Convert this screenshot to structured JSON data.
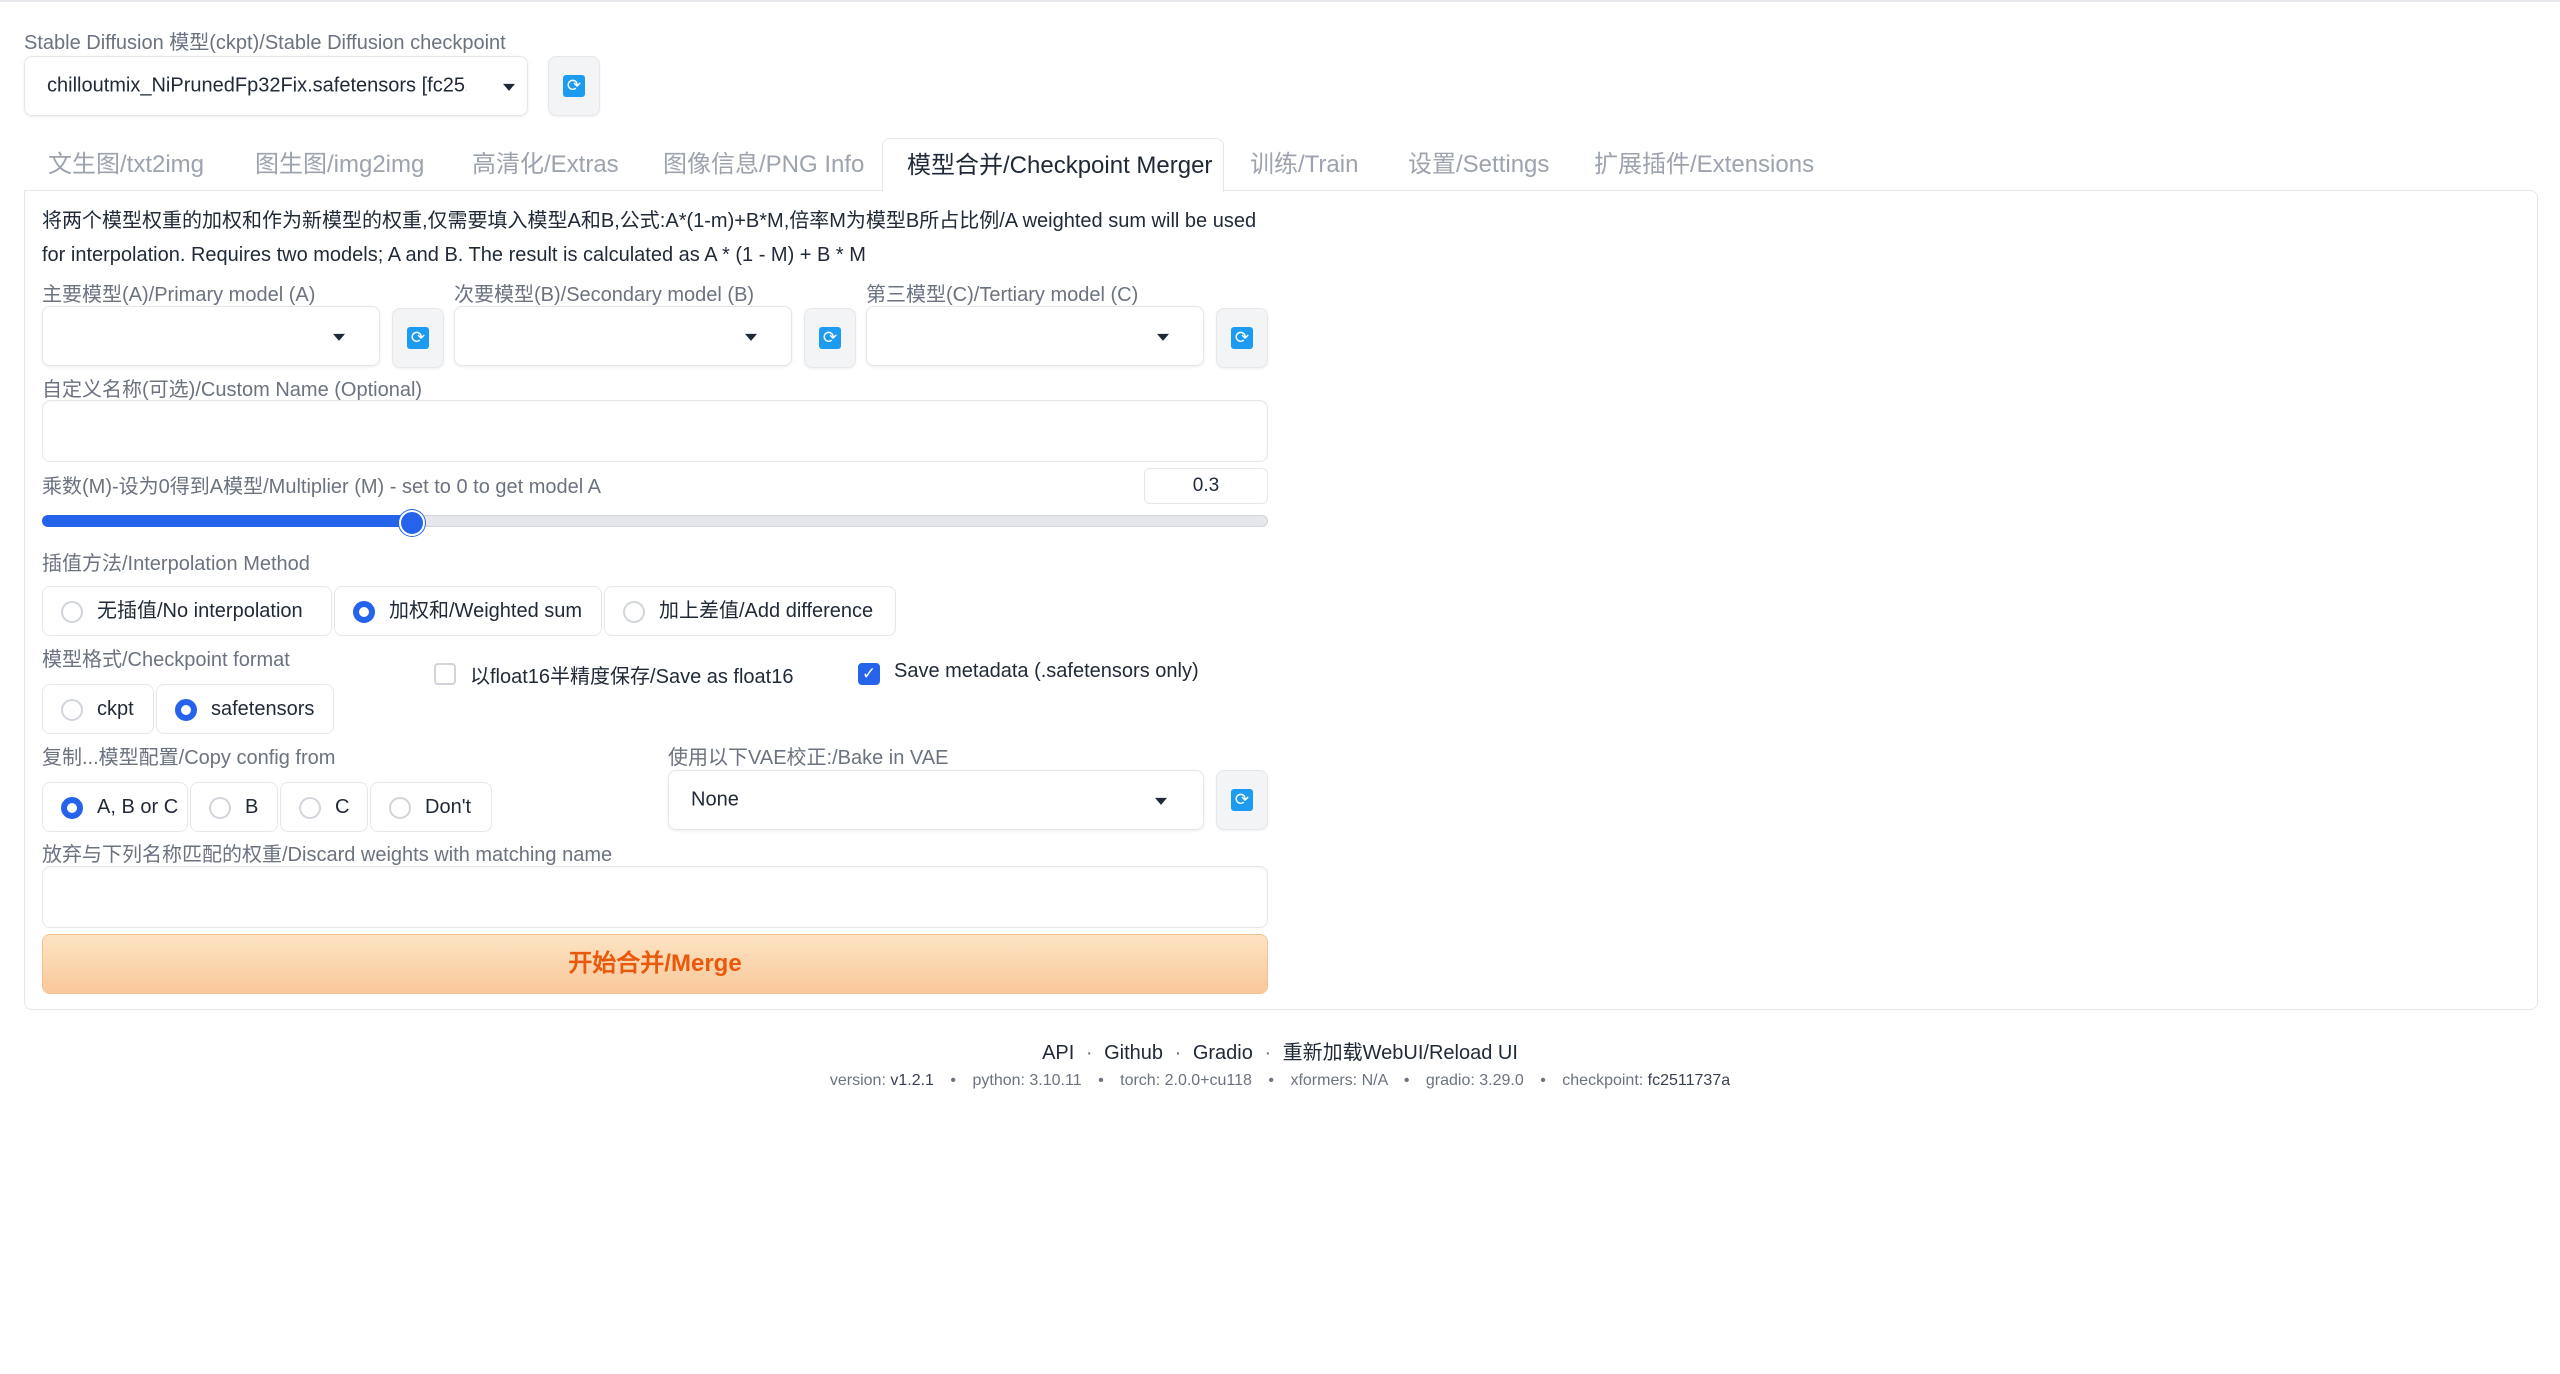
{
  "header": {
    "checkpoint_label": "Stable Diffusion 模型(ckpt)/Stable Diffusion checkpoint",
    "checkpoint_value": "chilloutmix_NiPrunedFp32Fix.safetensors [fc25."
  },
  "tabs": [
    {
      "label": "文生图/txt2img",
      "active": false
    },
    {
      "label": "图生图/img2img",
      "active": false
    },
    {
      "label": "高清化/Extras",
      "active": false
    },
    {
      "label": "图像信息/PNG Info",
      "active": false
    },
    {
      "label": "模型合并/Checkpoint Merger",
      "active": true
    },
    {
      "label": "训练/Train",
      "active": false
    },
    {
      "label": "设置/Settings",
      "active": false
    },
    {
      "label": "扩展插件/Extensions",
      "active": false
    }
  ],
  "merger": {
    "description": "将两个模型权重的加权和作为新模型的权重,仅需要填入模型A和B,公式:A*(1-m)+B*M,倍率M为模型B所占比例/A weighted sum will be used for interpolation. Requires two models; A and B. The result is calculated as A * (1 - M) + B * M",
    "primary_label": "主要模型(A)/Primary model (A)",
    "secondary_label": "次要模型(B)/Secondary model (B)",
    "tertiary_label": "第三模型(C)/Tertiary model (C)",
    "primary_value": "",
    "secondary_value": "",
    "tertiary_value": "",
    "custom_name_label": "自定义名称(可选)/Custom Name (Optional)",
    "custom_name_value": "",
    "multiplier_label": "乘数(M)-设为0得到A模型/Multiplier (M) - set to 0 to get model A",
    "multiplier_value": "0.3",
    "multiplier_fraction": 0.3,
    "interp_label": "插值方法/Interpolation Method",
    "interp_options": [
      {
        "label": "无插值/No interpolation",
        "selected": false
      },
      {
        "label": "加权和/Weighted sum",
        "selected": true
      },
      {
        "label": "加上差值/Add difference",
        "selected": false
      }
    ],
    "format_label": "模型格式/Checkpoint format",
    "format_options": [
      {
        "label": "ckpt",
        "selected": false
      },
      {
        "label": "safetensors",
        "selected": true
      }
    ],
    "float16_label": "以float16半精度保存/Save as float16",
    "float16_checked": false,
    "metadata_label": "Save metadata (.safetensors only)",
    "metadata_checked": true,
    "copy_config_label": "复制...模型配置/Copy config from",
    "copy_config_options": [
      {
        "label": "A, B or C",
        "selected": true
      },
      {
        "label": "B",
        "selected": false
      },
      {
        "label": "C",
        "selected": false
      },
      {
        "label": "Don't",
        "selected": false
      }
    ],
    "vae_label": "使用以下VAE校正:/Bake in VAE",
    "vae_value": "None",
    "discard_label": "放弃与下列名称匹配的权重/Discard weights with matching name",
    "discard_value": "",
    "merge_label": "开始合并/Merge"
  },
  "footer": {
    "links": [
      "API",
      "Github",
      "Gradio",
      "重新加载WebUI/Reload UI"
    ],
    "separator": "·",
    "version": {
      "label": "version:",
      "value": "v1.2.1"
    },
    "python": {
      "label": "python:",
      "value": "3.10.11"
    },
    "torch": {
      "label": "torch:",
      "value": "2.0.0+cu118"
    },
    "xformers": {
      "label": "xformers:",
      "value": "N/A"
    },
    "gradio": {
      "label": "gradio:",
      "value": "3.29.0"
    },
    "checkpoint": {
      "label": "checkpoint:",
      "value": "fc2511737a"
    },
    "bullet": "•"
  },
  "icons": {
    "refresh": "refresh-icon",
    "checkmark": "check-icon",
    "dropdown": "chevron-down-icon"
  },
  "colors": {
    "accent": "#2563eb",
    "refresh": "#1d9bf0",
    "merge_text": "#ea580c",
    "merge_bg": "#f8c89a"
  }
}
